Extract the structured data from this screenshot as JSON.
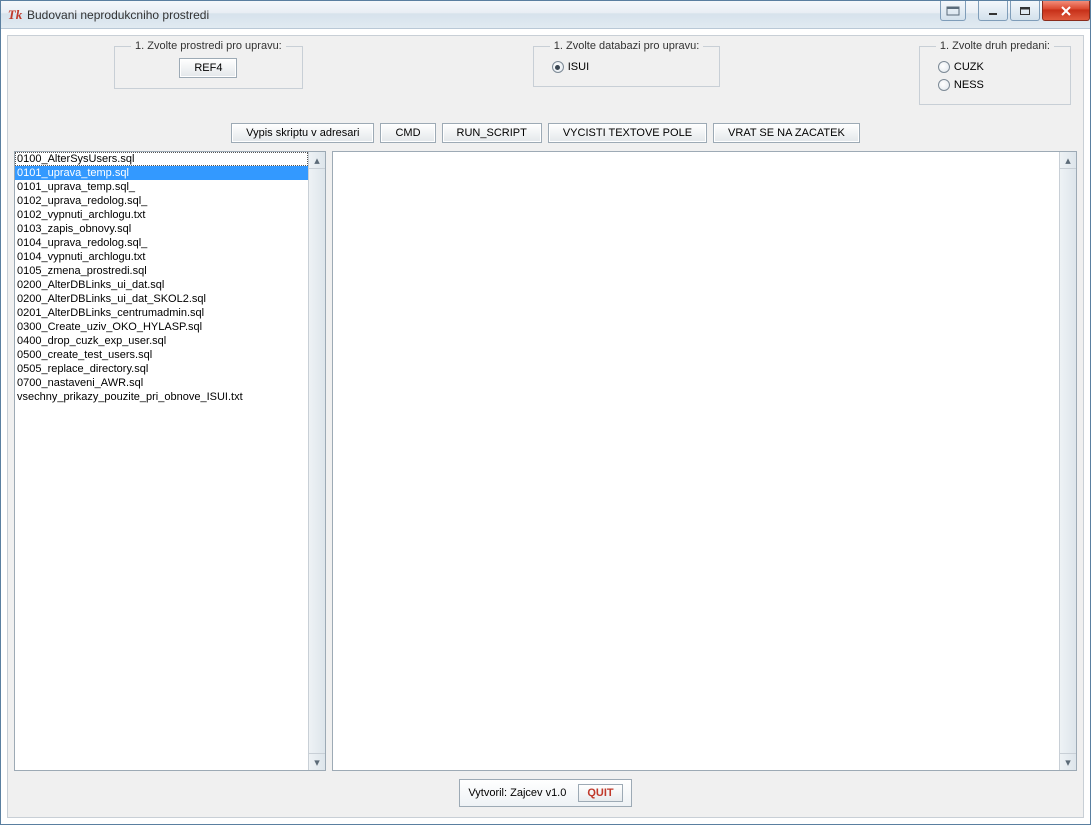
{
  "window": {
    "title": "Budovani neprodukcniho prostredi"
  },
  "groups": {
    "env": {
      "legend": "1. Zvolte prostredi pro upravu:",
      "button": "REF4"
    },
    "db": {
      "legend": "1. Zvolte databazi pro upravu:",
      "radios": [
        "ISUI"
      ],
      "selected": "ISUI"
    },
    "hand": {
      "legend": "1. Zvolte druh predani:",
      "radios": [
        "CUZK",
        "NESS"
      ],
      "selected": ""
    }
  },
  "toolbar": {
    "btn_vypis": "Vypis skriptu v adresari",
    "btn_cmd": "CMD",
    "btn_run": "RUN_SCRIPT",
    "btn_clear": "VYCISTI TEXTOVE POLE",
    "btn_back": "VRAT SE NA ZACATEK"
  },
  "listbox": {
    "selected_index": 1,
    "focused_index": 0,
    "items": [
      "0100_AlterSysUsers.sql",
      "0101_uprava_temp.sql",
      "0101_uprava_temp.sql_",
      "0102_uprava_redolog.sql_",
      "0102_vypnuti_archlogu.txt",
      "0103_zapis_obnovy.sql",
      "0104_uprava_redolog.sql_",
      "0104_vypnuti_archlogu.txt",
      "0105_zmena_prostredi.sql",
      "0200_AlterDBLinks_ui_dat.sql",
      "0200_AlterDBLinks_ui_dat_SKOL2.sql",
      "0201_AlterDBLinks_centrumadmin.sql",
      "0300_Create_uziv_OKO_HYLASP.sql",
      "0400_drop_cuzk_exp_user.sql",
      "0500_create_test_users.sql",
      "0505_replace_directory.sql",
      "0700_nastaveni_AWR.sql",
      "vsechny_prikazy_pouzite_pri_obnove_ISUI.txt"
    ]
  },
  "output_text": "",
  "footer": {
    "credits": "Vytvoril: Zajcev v1.0",
    "quit": "QUIT"
  }
}
